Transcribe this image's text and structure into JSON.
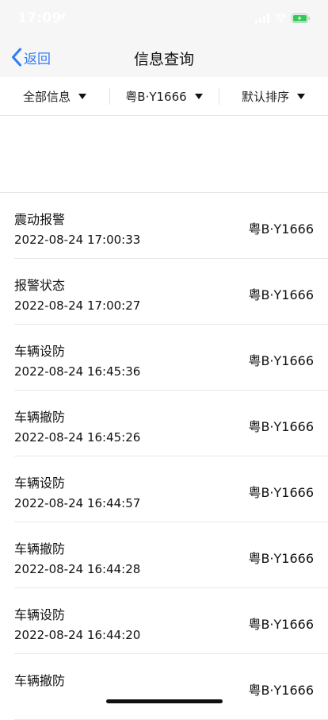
{
  "status_bar": {
    "time": "17:09",
    "icons": [
      "location-arrow-icon",
      "signal-icon",
      "wifi-icon",
      "battery-charging-icon"
    ]
  },
  "nav": {
    "back_label": "返回",
    "title": "信息查询"
  },
  "filters": [
    {
      "label": "全部信息"
    },
    {
      "label": "粤B·Y1666"
    },
    {
      "label": "默认排序"
    }
  ],
  "records": [
    {
      "title": "震动报警",
      "time": "2022-08-24 17:00:33",
      "plate": "粤B·Y1666"
    },
    {
      "title": "报警状态",
      "time": "2022-08-24 17:00:27",
      "plate": "粤B·Y1666"
    },
    {
      "title": "车辆设防",
      "time": "2022-08-24 16:45:36",
      "plate": "粤B·Y1666"
    },
    {
      "title": "车辆撤防",
      "time": "2022-08-24 16:45:26",
      "plate": "粤B·Y1666"
    },
    {
      "title": "车辆设防",
      "time": "2022-08-24 16:44:57",
      "plate": "粤B·Y1666"
    },
    {
      "title": "车辆撤防",
      "time": "2022-08-24 16:44:28",
      "plate": "粤B·Y1666"
    },
    {
      "title": "车辆设防",
      "time": "2022-08-24 16:44:20",
      "plate": "粤B·Y1666"
    },
    {
      "title": "车辆撤防",
      "time": "",
      "plate": "粤B·Y1666"
    }
  ],
  "colors": {
    "accent": "#2f7cf6",
    "header_bg": "#f6f6f6",
    "battery": "#34c759"
  }
}
